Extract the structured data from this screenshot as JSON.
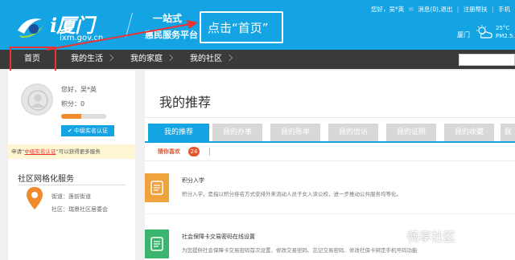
{
  "header": {
    "logo_name": "i厦门",
    "logo_domain": "ixm.gov.cn",
    "slogan_line1": "一站式",
    "slogan_line2": "惠民服务平台",
    "tip_text": "点击“首页”",
    "top_links": [
      "您好，吴*英",
      "消息(0),退出",
      "注册帮扶",
      "手机"
    ],
    "city": "厦门",
    "temp": "25°C",
    "aqi": "PM2.5..."
  },
  "nav": {
    "items": [
      {
        "label": "首页"
      },
      {
        "label": "我的生活"
      },
      {
        "label": "我的家庭"
      },
      {
        "label": "我的社区"
      }
    ],
    "search_placeholder": ""
  },
  "sidebar": {
    "greeting": "您好，吴*英",
    "points": "积分：0",
    "progress_percent": 45,
    "verify_label": "中级实名认证",
    "notice_prefix": "申请“",
    "notice_link": "中级实名认证",
    "notice_suffix": "”可以获得更多服务",
    "section_title": "社区网格化服务",
    "street": "街道：莲前街道",
    "community": "社区：瑞景社区居委会"
  },
  "main": {
    "title": "我的推荐",
    "tabs": [
      {
        "label": "我的推荐"
      },
      {
        "label": "我的办事"
      },
      {
        "label": "我的账单"
      },
      {
        "label": "我的信访"
      },
      {
        "label": "我的证照"
      },
      {
        "label": "我的收藏"
      },
      {
        "label": "我"
      }
    ],
    "subtab": "猜你喜欢",
    "subtab_count": "24",
    "items": [
      {
        "title": "积分入学",
        "desc": "积分入学，是指以积分排名方式安排外来流动人员子女入读公校，进一步推动公共服务均等化。"
      },
      {
        "title": "社会保障卡交易密码在线设置",
        "desc": "为您提供社会保障卡交易密码首次设置、修改交易密码、忘记交易密码、修改社保卡绑定手机号码功能"
      }
    ]
  },
  "watermark": "畅享社区",
  "colors": {
    "brand": "#14a3e3",
    "nav": "#3a3a3a",
    "accent": "#e5562c",
    "annotation": "#e33333"
  }
}
